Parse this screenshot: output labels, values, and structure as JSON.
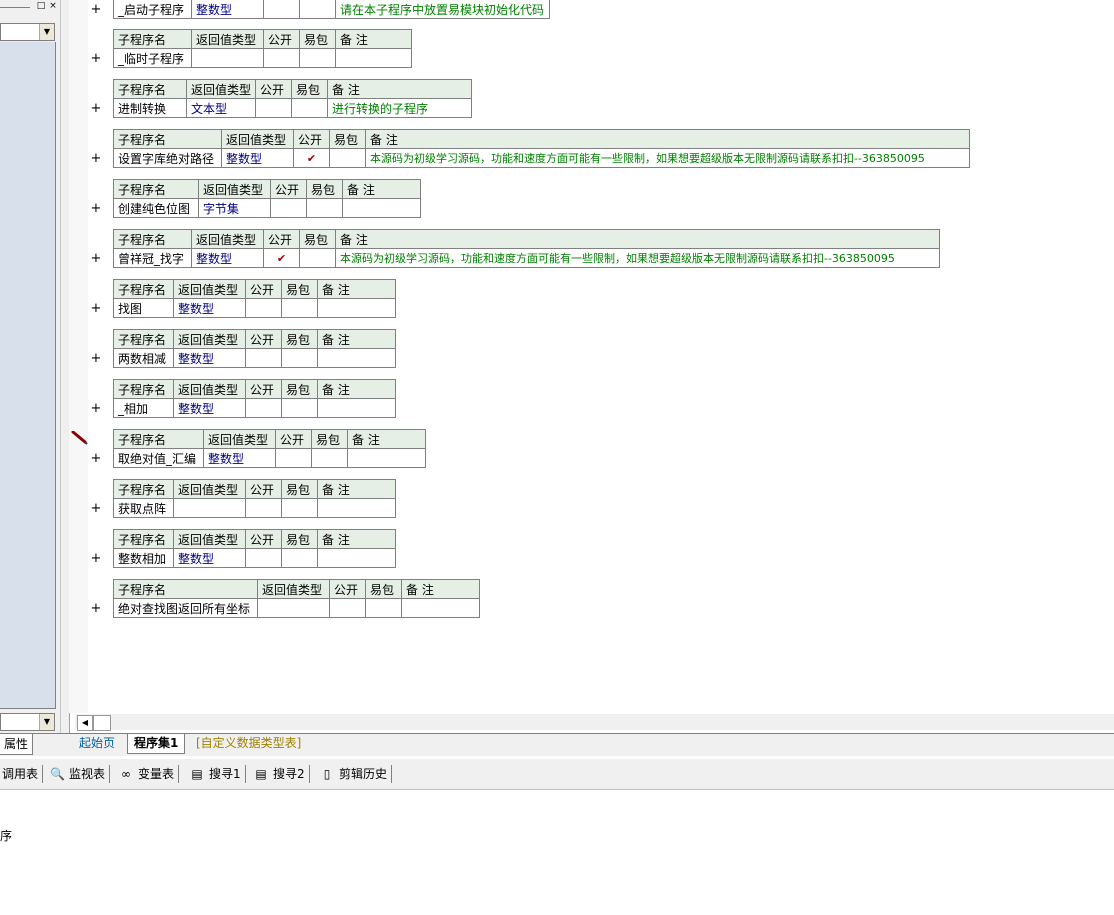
{
  "left_panel": {
    "props_tab_label": "属性"
  },
  "table_headers": {
    "name": "子程序名",
    "return_type": "返回值类型",
    "public": "公开",
    "easy_pkg": "易包",
    "note": "备 注"
  },
  "subroutines": [
    {
      "name": "_启动子程序",
      "return_type": "整数型",
      "public": "",
      "note": "请在本子程序中放置易模块初始化代码"
    },
    {
      "name": "_临时子程序",
      "return_type": "",
      "public": "",
      "note": ""
    },
    {
      "name": "进制转换",
      "return_type": "文本型",
      "public": "",
      "note": "进行转换的子程序"
    },
    {
      "name": "设置字库绝对路径",
      "return_type": "整数型",
      "public": "✔",
      "note": "本源码为初级学习源码，功能和速度方面可能有一些限制，如果想要超级版本无限制源码请联系扣扣--363850095"
    },
    {
      "name": "创建纯色位图",
      "return_type": "字节集",
      "public": "",
      "note": ""
    },
    {
      "name": "曾祥冠_找字",
      "return_type": "整数型",
      "public": "✔",
      "note": "本源码为初级学习源码，功能和速度方面可能有一些限制，如果想要超级版本无限制源码请联系扣扣--363850095"
    },
    {
      "name": "找图",
      "return_type": "整数型",
      "public": "",
      "note": ""
    },
    {
      "name": "两数相减",
      "return_type": "整数型",
      "public": "",
      "note": ""
    },
    {
      "name": "_相加",
      "return_type": "整数型",
      "public": "",
      "note": ""
    },
    {
      "name": "取绝对值_汇编",
      "return_type": "整数型",
      "public": "",
      "note": ""
    },
    {
      "name": "获取点阵",
      "return_type": "",
      "public": "",
      "note": ""
    },
    {
      "name": "整数相加",
      "return_type": "整数型",
      "public": "",
      "note": ""
    },
    {
      "name": "绝对查找图返回所有坐标",
      "return_type": "",
      "public": "",
      "note": ""
    }
  ],
  "expand_symbol": "+",
  "tabs": {
    "home": "起始页",
    "program_set": "程序集1",
    "custom_types": "[自定义数据类型表]"
  },
  "toolbar": {
    "call_table": "调用表",
    "watch_table": "监视表",
    "var_table": "变量表",
    "search1": "搜寻1",
    "search2": "搜寻2",
    "clip_history": "剪辑历史"
  },
  "bottom_text": "序"
}
